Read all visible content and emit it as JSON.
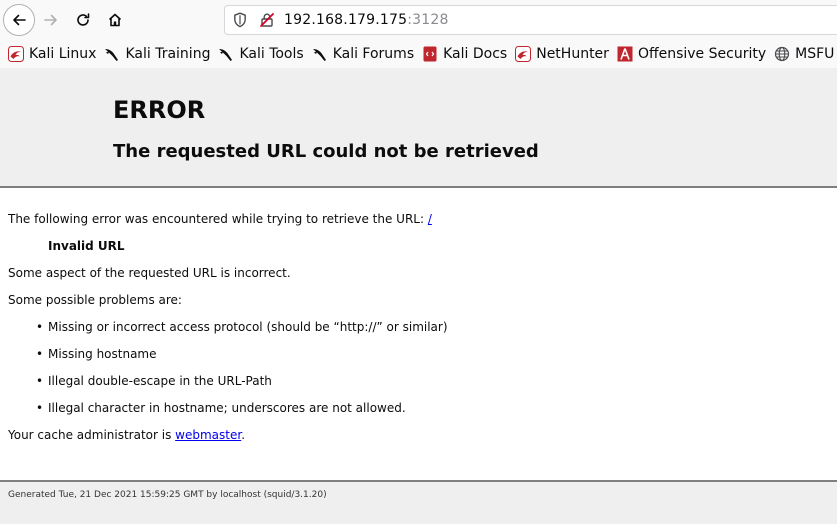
{
  "browser": {
    "url_host": "192.168.179.175",
    "url_port": ":3128"
  },
  "bookmarks": [
    {
      "label": "Kali Linux",
      "icon": "kali-dragon-icon"
    },
    {
      "label": "Kali Training",
      "icon": "kali-dragon-icon"
    },
    {
      "label": "Kali Tools",
      "icon": "kali-dragon-icon"
    },
    {
      "label": "Kali Forums",
      "icon": "kali-dragon-icon"
    },
    {
      "label": "Kali Docs",
      "icon": "kali-docs-icon"
    },
    {
      "label": "NetHunter",
      "icon": "kali-dragon-icon"
    },
    {
      "label": "Offensive Security",
      "icon": "offsec-icon"
    },
    {
      "label": "MSFU",
      "icon": "globe-icon"
    }
  ],
  "error_page": {
    "heading": "ERROR",
    "subheading": "The requested URL could not be retrieved",
    "intro": "The following error was encountered while trying to retrieve the URL: ",
    "intro_link": "/",
    "error_name": "Invalid URL",
    "description": "Some aspect of the requested URL is incorrect.",
    "problems_intro": "Some possible problems are:",
    "problems": [
      "Missing or incorrect access protocol (should be “http://” or similar)",
      "Missing hostname",
      "Illegal double-escape in the URL-Path",
      "Illegal character in hostname; underscores are not allowed."
    ],
    "admin_text": "Your cache administrator is ",
    "admin_link": "webmaster",
    "admin_suffix": ".",
    "footer": "Generated Tue, 21 Dec 2021 15:59:25 GMT by localhost (squid/3.1.20)"
  },
  "colors": {
    "link": "#0000ee",
    "header_bg": "#efefef",
    "divider": "#7f7f7f",
    "bookmark_red": "#c0262d"
  }
}
